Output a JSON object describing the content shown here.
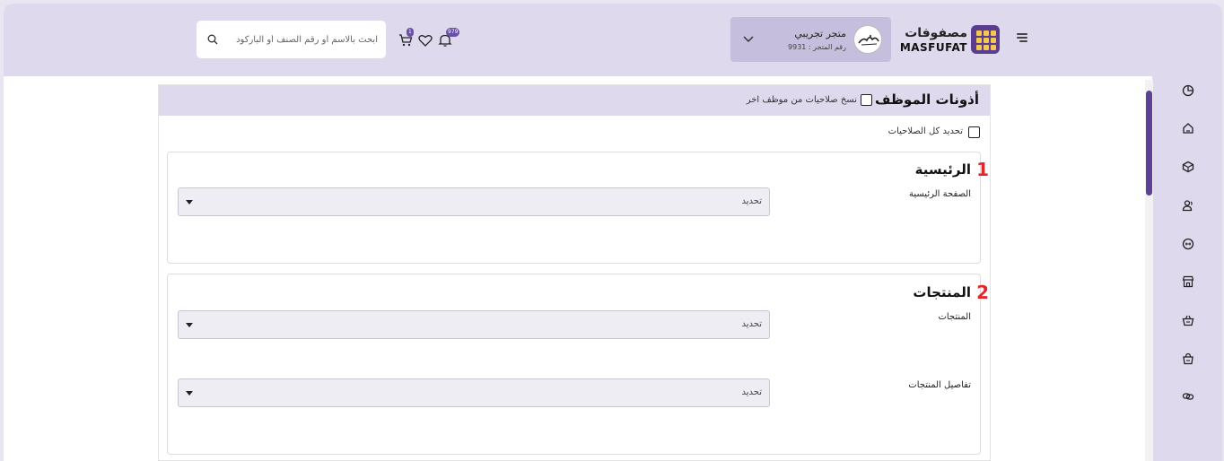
{
  "header": {
    "logo_ar": "مصفوفات",
    "logo_en": "MASFUFAT",
    "store_name": "متجر تجريبي",
    "store_number": "رقم المتجر : 9931",
    "notifications_count": "979",
    "cart_count": "1",
    "search_placeholder": "ابحث بالاسم أو رقم الصنف أو الباركود"
  },
  "sidebar": {
    "icons": [
      "dashboard-icon",
      "home-icon",
      "box-icon",
      "users-icon",
      "tag-icon",
      "store-icon",
      "basket-icon",
      "bag-icon",
      "link-icon"
    ]
  },
  "panel": {
    "title": "أذونات الموظف",
    "copy_permissions_label": "نسخ صلاحيات من موظف اخر",
    "select_all_label": "تحديد كل الصلاحيات"
  },
  "sections": [
    {
      "number": "1",
      "title": "الرئيسية",
      "fields": [
        {
          "label": "الصفحة الرئيسية",
          "value": "تحديد"
        }
      ]
    },
    {
      "number": "2",
      "title": "المنتجات",
      "fields": [
        {
          "label": "المنتجات",
          "value": "تحديد"
        },
        {
          "label": "تفاصيل المنتجات",
          "value": "تحديد"
        }
      ]
    }
  ],
  "colors": {
    "accent": "#5b4296",
    "header_bg": "#ded9ec",
    "section_number": "#e3262b"
  }
}
